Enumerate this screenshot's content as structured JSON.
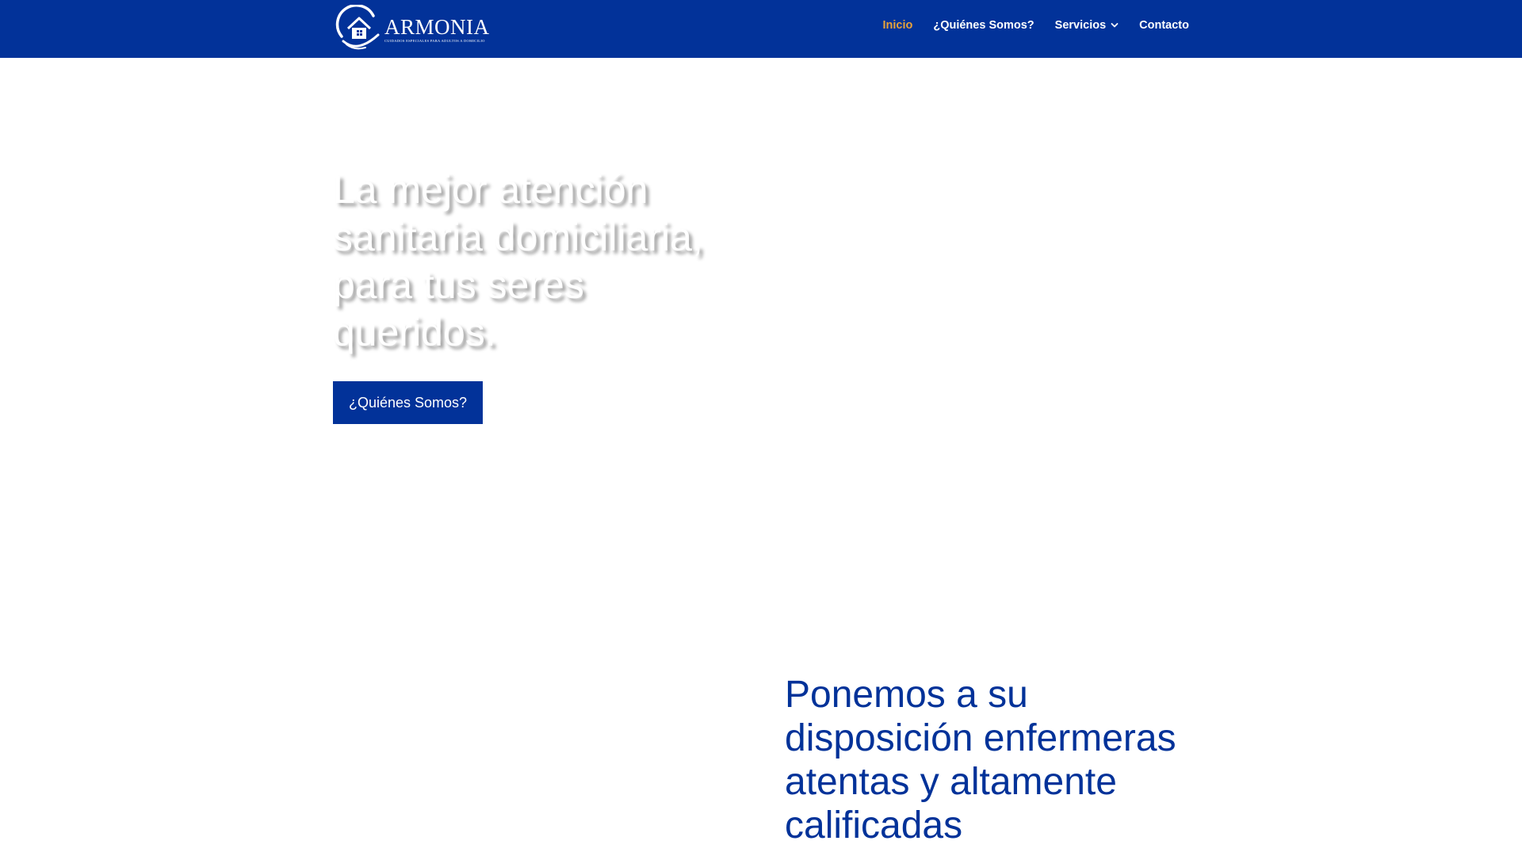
{
  "header": {
    "logo": {
      "name": "ARMONIA",
      "tagline": "CUIDADOS ESPECIALES PARA ADULTOS A DOMICILIO"
    },
    "nav": [
      {
        "label": "Inicio",
        "active": true
      },
      {
        "label": "¿Quiénes Somos?",
        "active": false
      },
      {
        "label": "Servicios",
        "active": false,
        "has_dropdown": true
      },
      {
        "label": "Contacto",
        "active": false
      }
    ]
  },
  "hero": {
    "title": "La mejor atención sanitaria domiciliaria, para tus seres queridos.",
    "button_label": "¿Quiénes Somos?"
  },
  "section2": {
    "title": "Ponemos a su disposición enfermeras atentas y altamente calificadas"
  },
  "colors": {
    "brand_blue": "#023299",
    "active_nav": "#e8a23a",
    "text_on_brand": "#ffffff"
  },
  "icons": {
    "logo": "house-in-hands-icon",
    "servicios_dropdown": "chevron-down-icon"
  }
}
